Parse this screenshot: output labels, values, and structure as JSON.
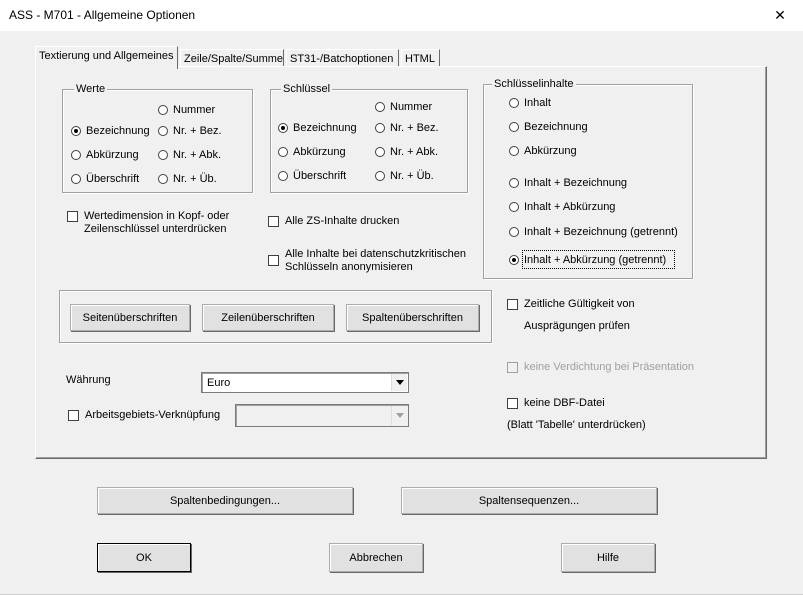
{
  "window": {
    "title": "ASS - M701 - Allgemeine Optionen",
    "close_glyph": "✕"
  },
  "tabs": [
    {
      "label": "Textierung und Allgemeines",
      "active": true
    },
    {
      "label": "Zeile/Spalte/Summe",
      "active": false
    },
    {
      "label": "ST31-/Batchoptionen",
      "active": false
    },
    {
      "label": "HTML",
      "active": false
    }
  ],
  "werte": {
    "title": "Werte",
    "options": [
      "Nummer",
      "Bezeichnung",
      "Nr. + Bez.",
      "Abkürzung",
      "Nr. + Abk.",
      "Überschrift",
      "Nr. + Üb."
    ],
    "selected": "Bezeichnung"
  },
  "schluessel": {
    "title": "Schlüssel",
    "options": [
      "Nummer",
      "Bezeichnung",
      "Nr. + Bez.",
      "Abkürzung",
      "Nr. + Abk.",
      "Überschrift",
      "Nr. + Üb."
    ],
    "selected": "Bezeichnung"
  },
  "schluesselinhalte": {
    "title": "Schlüsselinhalte",
    "options": [
      "Inhalt",
      "Bezeichnung",
      "Abkürzung",
      "Inhalt + Bezeichnung",
      "Inhalt + Abkürzung",
      "Inhalt + Bezeichnung (getrennt)",
      "Inhalt + Abkürzung (getrennt)"
    ],
    "selected": "Inhalt + Abkürzung (getrennt)"
  },
  "checkboxes": {
    "wertedimension_line1": "Wertedimension in Kopf- oder",
    "wertedimension_line2": "Zeilenschlüssel unterdrücken",
    "alle_zs": "Alle ZS-Inhalte drucken",
    "anonym_line1": "Alle Inhalte bei datenschutzkritischen",
    "anonym_line2": "Schlüsseln anonymisieren",
    "zeitliche_line1": "Zeitliche Gültigkeit von",
    "zeitliche_line2": "Ausprägungen prüfen",
    "keine_verdichtung": "keine Verdichtung bei Präsentation",
    "keine_dbf": "keine DBF-Datei",
    "keine_dbf_note": "(Blatt 'Tabelle' unterdrücken)",
    "arbeitsgebiet": "Arbeitsgebiets-Verknüpfung"
  },
  "header_buttons": {
    "seiten": "Seitenüberschriften",
    "zeilen": "Zeilenüberschriften",
    "spalten": "Spaltenüberschriften"
  },
  "waehrung": {
    "label": "Währung",
    "value": "Euro"
  },
  "arbeitsgebiet_value": "",
  "bottom_buttons": {
    "spaltenbedingungen": "Spaltenbedingungen...",
    "spaltensequenzen": "Spaltensequenzen...",
    "ok": "OK",
    "abbrechen": "Abbrechen",
    "hilfe": "Hilfe"
  }
}
